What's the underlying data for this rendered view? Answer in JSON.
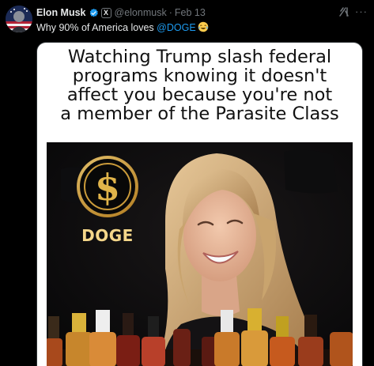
{
  "tweet": {
    "author_name": "Elon Musk",
    "handle": "@elonmusk",
    "separator": "·",
    "date": "Feb 13",
    "affiliate_badge": "X",
    "text_before": "Why 90% of America loves ",
    "mention": "@DOGE",
    "emoji": "face-with-tears-of-joy",
    "more_label": "···"
  },
  "media": {
    "caption_lines": [
      "Watching Trump slash federal",
      "programs knowing it doesn't",
      "affect you because you're not",
      "a member of the Parasite Class"
    ],
    "logo_label": "DOGE"
  },
  "colors": {
    "background": "#000000",
    "text_primary": "#e7e9ea",
    "text_secondary": "#71767b",
    "link": "#1d9bf0",
    "verified": "#1d9bf0",
    "doge_gold": "#e0b44a"
  }
}
